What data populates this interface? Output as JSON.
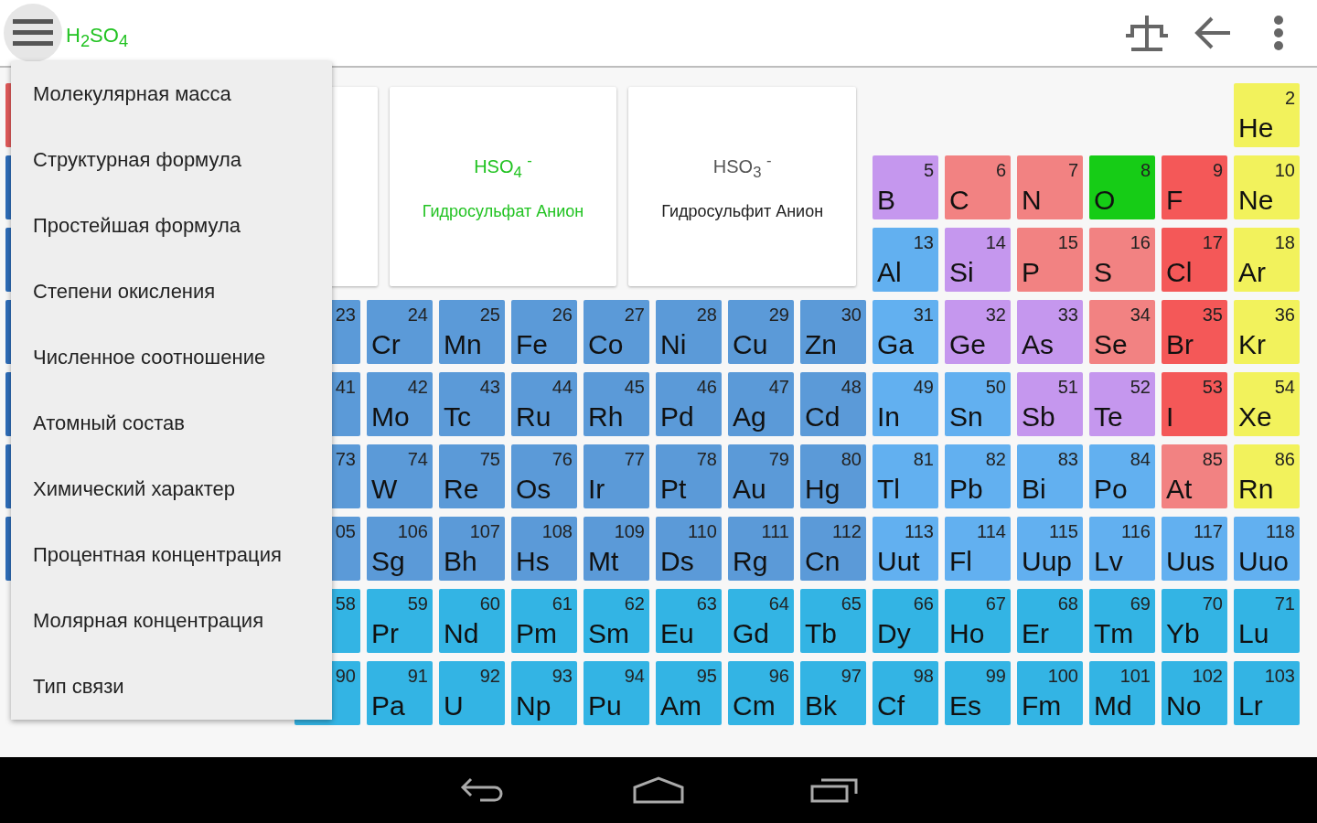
{
  "app_bar": {
    "title": "H$_{2}$SO$_{4}$"
  },
  "cards": [
    {
      "formula": "HSO$_{4}$ $^{-}$",
      "name": "Гидросульфат Анион",
      "selected": true
    },
    {
      "formula": "HSO$_{3}$ $^{-}$",
      "name": "Гидросульфит Анион",
      "selected": false
    }
  ],
  "table_rows": [
    {
      "edge_tile": {
        "color": "#e05a5a"
      },
      "tiles": [
        {
          "number": "2",
          "symbol": "He",
          "color": "#f2f25c"
        }
      ]
    },
    {
      "edge_tile": {
        "color": "#2f6db8"
      },
      "tiles": [
        {
          "number": "5",
          "symbol": "B",
          "color": "#c597ee"
        },
        {
          "number": "6",
          "symbol": "C",
          "color": "#f28282"
        },
        {
          "number": "7",
          "symbol": "N",
          "color": "#f28282"
        },
        {
          "number": "8",
          "symbol": "O",
          "color": "#16cc16"
        },
        {
          "number": "9",
          "symbol": "F",
          "color": "#f45858"
        },
        {
          "number": "10",
          "symbol": "Ne",
          "color": "#f2f25c"
        }
      ]
    },
    {
      "edge_tile": {
        "color": "#2f6db8"
      },
      "tiles": [
        {
          "number": "13",
          "symbol": "Al",
          "color": "#62b0f0"
        },
        {
          "number": "14",
          "symbol": "Si",
          "color": "#c597ee"
        },
        {
          "number": "15",
          "symbol": "P",
          "color": "#f28282"
        },
        {
          "number": "16",
          "symbol": "S",
          "color": "#f28282"
        },
        {
          "number": "17",
          "symbol": "Cl",
          "color": "#f45858"
        },
        {
          "number": "18",
          "symbol": "Ar",
          "color": "#f2f25c"
        }
      ]
    },
    {
      "edge_tile": {
        "color": "#2f6db8"
      },
      "tiles": [
        {
          "number": "23",
          "color": "#5b9ad8"
        },
        {
          "number": "24",
          "symbol": "Cr",
          "color": "#5b9ad8"
        },
        {
          "number": "25",
          "symbol": "Mn",
          "color": "#5b9ad8"
        },
        {
          "number": "26",
          "symbol": "Fe",
          "color": "#5b9ad8"
        },
        {
          "number": "27",
          "symbol": "Co",
          "color": "#5b9ad8"
        },
        {
          "number": "28",
          "symbol": "Ni",
          "color": "#5b9ad8"
        },
        {
          "number": "29",
          "symbol": "Cu",
          "color": "#5b9ad8"
        },
        {
          "number": "30",
          "symbol": "Zn",
          "color": "#5b9ad8"
        },
        {
          "number": "31",
          "symbol": "Ga",
          "color": "#62b0f0"
        },
        {
          "number": "32",
          "symbol": "Ge",
          "color": "#c597ee"
        },
        {
          "number": "33",
          "symbol": "As",
          "color": "#c597ee"
        },
        {
          "number": "34",
          "symbol": "Se",
          "color": "#f28282"
        },
        {
          "number": "35",
          "symbol": "Br",
          "color": "#f45858"
        },
        {
          "number": "36",
          "symbol": "Kr",
          "color": "#f2f25c"
        }
      ]
    },
    {
      "edge_tile": {
        "color": "#2f6db8"
      },
      "tiles": [
        {
          "number": "41",
          "color": "#5b9ad8"
        },
        {
          "number": "42",
          "symbol": "Mo",
          "color": "#5b9ad8"
        },
        {
          "number": "43",
          "symbol": "Tc",
          "color": "#5b9ad8"
        },
        {
          "number": "44",
          "symbol": "Ru",
          "color": "#5b9ad8"
        },
        {
          "number": "45",
          "symbol": "Rh",
          "color": "#5b9ad8"
        },
        {
          "number": "46",
          "symbol": "Pd",
          "color": "#5b9ad8"
        },
        {
          "number": "47",
          "symbol": "Ag",
          "color": "#5b9ad8"
        },
        {
          "number": "48",
          "symbol": "Cd",
          "color": "#5b9ad8"
        },
        {
          "number": "49",
          "symbol": "In",
          "color": "#62b0f0"
        },
        {
          "number": "50",
          "symbol": "Sn",
          "color": "#62b0f0"
        },
        {
          "number": "51",
          "symbol": "Sb",
          "color": "#c597ee"
        },
        {
          "number": "52",
          "symbol": "Te",
          "color": "#c597ee"
        },
        {
          "number": "53",
          "symbol": "I",
          "color": "#f45858"
        },
        {
          "number": "54",
          "symbol": "Xe",
          "color": "#f2f25c"
        }
      ]
    },
    {
      "edge_tile": {
        "color": "#2f6db8"
      },
      "tiles": [
        {
          "number": "73",
          "color": "#5b9ad8"
        },
        {
          "number": "74",
          "symbol": "W",
          "color": "#5b9ad8"
        },
        {
          "number": "75",
          "symbol": "Re",
          "color": "#5b9ad8"
        },
        {
          "number": "76",
          "symbol": "Os",
          "color": "#5b9ad8"
        },
        {
          "number": "77",
          "symbol": "Ir",
          "color": "#5b9ad8"
        },
        {
          "number": "78",
          "symbol": "Pt",
          "color": "#5b9ad8"
        },
        {
          "number": "79",
          "symbol": "Au",
          "color": "#5b9ad8"
        },
        {
          "number": "80",
          "symbol": "Hg",
          "color": "#5b9ad8"
        },
        {
          "number": "81",
          "symbol": "Tl",
          "color": "#62b0f0"
        },
        {
          "number": "82",
          "symbol": "Pb",
          "color": "#62b0f0"
        },
        {
          "number": "83",
          "symbol": "Bi",
          "color": "#62b0f0"
        },
        {
          "number": "84",
          "symbol": "Po",
          "color": "#62b0f0"
        },
        {
          "number": "85",
          "symbol": "At",
          "color": "#f28282"
        },
        {
          "number": "86",
          "symbol": "Rn",
          "color": "#f2f25c"
        }
      ]
    },
    {
      "edge_tile": {
        "color": "#2f6db8"
      },
      "tiles": [
        {
          "number": "05",
          "color": "#5b9ad8"
        },
        {
          "number": "106",
          "symbol": "Sg",
          "color": "#5b9ad8"
        },
        {
          "number": "107",
          "symbol": "Bh",
          "color": "#5b9ad8"
        },
        {
          "number": "108",
          "symbol": "Hs",
          "color": "#5b9ad8"
        },
        {
          "number": "109",
          "symbol": "Mt",
          "color": "#5b9ad8"
        },
        {
          "number": "110",
          "symbol": "Ds",
          "color": "#5b9ad8"
        },
        {
          "number": "111",
          "symbol": "Rg",
          "color": "#5b9ad8"
        },
        {
          "number": "112",
          "symbol": "Cn",
          "color": "#5b9ad8"
        },
        {
          "number": "113",
          "symbol": "Uut",
          "color": "#62b0f0"
        },
        {
          "number": "114",
          "symbol": "Fl",
          "color": "#62b0f0"
        },
        {
          "number": "115",
          "symbol": "Uup",
          "color": "#62b0f0"
        },
        {
          "number": "116",
          "symbol": "Lv",
          "color": "#62b0f0"
        },
        {
          "number": "117",
          "symbol": "Uus",
          "color": "#62b0f0"
        },
        {
          "number": "118",
          "symbol": "Uuo",
          "color": "#62b0f0"
        }
      ]
    },
    {
      "tiles": [
        {
          "number": "58",
          "color": "#33b4e4"
        },
        {
          "number": "59",
          "symbol": "Pr",
          "color": "#33b4e4"
        },
        {
          "number": "60",
          "symbol": "Nd",
          "color": "#33b4e4"
        },
        {
          "number": "61",
          "symbol": "Pm",
          "color": "#33b4e4"
        },
        {
          "number": "62",
          "symbol": "Sm",
          "color": "#33b4e4"
        },
        {
          "number": "63",
          "symbol": "Eu",
          "color": "#33b4e4"
        },
        {
          "number": "64",
          "symbol": "Gd",
          "color": "#33b4e4"
        },
        {
          "number": "65",
          "symbol": "Tb",
          "color": "#33b4e4"
        },
        {
          "number": "66",
          "symbol": "Dy",
          "color": "#33b4e4"
        },
        {
          "number": "67",
          "symbol": "Ho",
          "color": "#33b4e4"
        },
        {
          "number": "68",
          "symbol": "Er",
          "color": "#33b4e4"
        },
        {
          "number": "69",
          "symbol": "Tm",
          "color": "#33b4e4"
        },
        {
          "number": "70",
          "symbol": "Yb",
          "color": "#33b4e4"
        },
        {
          "number": "71",
          "symbol": "Lu",
          "color": "#33b4e4"
        }
      ]
    },
    {
      "tiles": [
        {
          "number": "90",
          "color": "#33b4e4"
        },
        {
          "number": "91",
          "symbol": "Pa",
          "color": "#33b4e4"
        },
        {
          "number": "92",
          "symbol": "U",
          "color": "#33b4e4"
        },
        {
          "number": "93",
          "symbol": "Np",
          "color": "#33b4e4"
        },
        {
          "number": "94",
          "symbol": "Pu",
          "color": "#33b4e4"
        },
        {
          "number": "95",
          "symbol": "Am",
          "color": "#33b4e4"
        },
        {
          "number": "96",
          "symbol": "Cm",
          "color": "#33b4e4"
        },
        {
          "number": "97",
          "symbol": "Bk",
          "color": "#33b4e4"
        },
        {
          "number": "98",
          "symbol": "Cf",
          "color": "#33b4e4"
        },
        {
          "number": "99",
          "symbol": "Es",
          "color": "#33b4e4"
        },
        {
          "number": "100",
          "symbol": "Fm",
          "color": "#33b4e4"
        },
        {
          "number": "101",
          "symbol": "Md",
          "color": "#33b4e4"
        },
        {
          "number": "102",
          "symbol": "No",
          "color": "#33b4e4"
        },
        {
          "number": "103",
          "symbol": "Lr",
          "color": "#33b4e4"
        }
      ]
    }
  ],
  "menu": {
    "items": [
      "Молекулярная масса",
      "Структурная формула",
      "Простейшая формула",
      "Степени окисления",
      "Численное соотношение",
      "Атомный состав",
      "Химический характер",
      "Процентная концентрация",
      "Молярная концентрация",
      "Тип связи"
    ]
  }
}
